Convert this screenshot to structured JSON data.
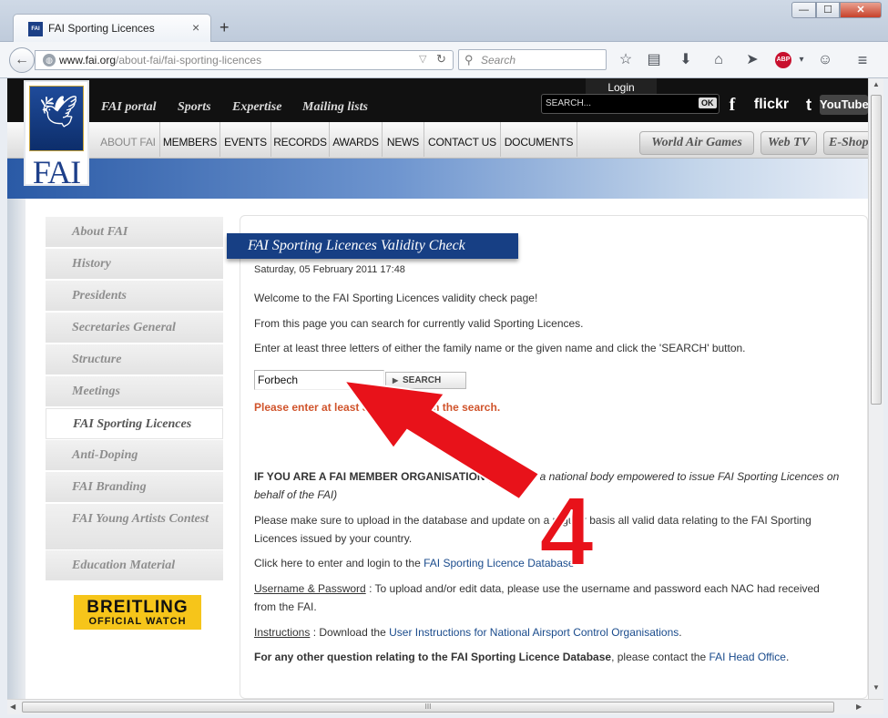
{
  "browser": {
    "tab_title": "FAI Sporting Licences",
    "favicon_text": "FAI",
    "tab_close": "×",
    "new_tab": "+",
    "url_domain": "www.fai.org",
    "url_path": "/about-fai/fai-sporting-licences",
    "search_placeholder": "Search",
    "window_buttons": {
      "minimize": "—",
      "maximize": "☐",
      "close": "✕"
    },
    "toolbar_icons": [
      "star-icon",
      "reading-list-icon",
      "download-icon",
      "home-icon",
      "send-icon",
      "adblock-icon",
      "smiley-icon",
      "menu-icon"
    ],
    "abp_label": "ABP"
  },
  "site": {
    "logo_text": "FAI",
    "top_nav": [
      "FAI portal",
      "Sports",
      "Expertise",
      "Mailing lists"
    ],
    "header_search_placeholder": "SEARCH...",
    "header_search_ok": "OK",
    "login": "Login",
    "social": {
      "facebook": "f",
      "flickr": "flickr",
      "twitter": "t",
      "youtube": "YouTube"
    },
    "main_nav": [
      "ABOUT FAI",
      "MEMBERS",
      "EVENTS",
      "RECORDS",
      "AWARDS",
      "NEWS",
      "CONTACT US",
      "DOCUMENTS"
    ],
    "right_buttons": [
      "World Air Games",
      "Web TV",
      "E-Shop"
    ]
  },
  "sidebar": {
    "items": [
      "About FAI",
      "History",
      "Presidents",
      "Secretaries General",
      "Structure",
      "Meetings",
      "FAI Sporting Licences",
      "Anti-Doping",
      "FAI Branding",
      "FAI Young Artists Contest",
      "Education Material"
    ],
    "active": "FAI Sporting Licences",
    "sponsor_name": "BREITLING",
    "sponsor_sub": "OFFICIAL WATCH"
  },
  "main": {
    "title": "FAI Sporting Licences Validity Check",
    "date": "Saturday, 05 February 2011 17:48",
    "welcome": "Welcome to the FAI Sporting Licences validity check page!",
    "intro": "From this page you can search for currently valid Sporting Licences.",
    "instruction": "Enter at least three letters of either the family name or the given name and click the 'SEARCH' button.",
    "search_value": "Forbech",
    "search_button": "SEARCH",
    "error": "Please enter at least 3 characters in the search.",
    "member_heading": "IF YOU ARE A FAI MEMBER ORGANISATION",
    "member_heading_note_1": "(a NAC or a national body empowered to issue FAI Sporting Licences on",
    "member_heading_note_2": "behalf of the FAI)",
    "upload_1": "Please make sure to upload in the database and update on a regular basis all valid data relating to the FAI Sporting",
    "upload_2": "Licences issued by your country.",
    "click_here": "Click here to enter and login to the",
    "db_link": "FAI Sporting Licence Database",
    "username_label": "Username & Password",
    "username_text_1": ": To upload and/or edit data, please use the username and password each NAC had received",
    "username_text_2": "from the FAI.",
    "instructions_label": "Instructions",
    "instructions_text": ": Download the",
    "instructions_link": "User Instructions for National Airsport Control Organisations",
    "other_question_bold": "For any other question relating to the FAI Sporting Licence Database",
    "other_question_text": ", please contact the",
    "head_office_link": "FAI Head Office"
  },
  "annotation": {
    "number": "4",
    "color": "#e8121a"
  }
}
